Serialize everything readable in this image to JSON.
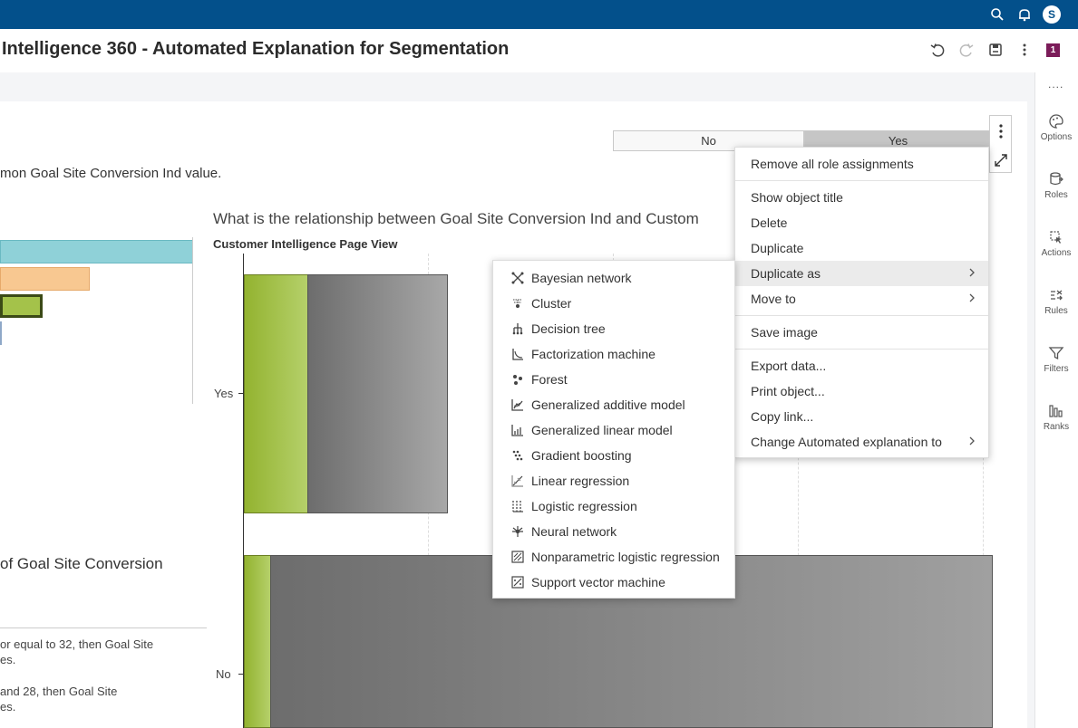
{
  "topbar": {
    "avatar_letter": "S",
    "search_icon": "search-icon",
    "notifications_icon": "bell-icon"
  },
  "header": {
    "title": "Intelligence 360 - Automated Explanation for Segmentation",
    "page_count": "1",
    "icons": [
      "undo-icon",
      "redo-icon",
      "save-icon",
      "more-vertical-icon"
    ]
  },
  "rail": {
    "more": "....",
    "items": [
      {
        "label": "Options",
        "icon": "palette-icon"
      },
      {
        "label": "Roles",
        "icon": "database-icon"
      },
      {
        "label": "Actions",
        "icon": "cursor-icon"
      },
      {
        "label": "Rules",
        "icon": "rules-icon"
      },
      {
        "label": "Filters",
        "icon": "filter-icon"
      },
      {
        "label": "Ranks",
        "icon": "ranks-icon"
      }
    ]
  },
  "toggle": {
    "no": "No",
    "yes": "Yes",
    "selected": "Yes"
  },
  "content": {
    "explain_text": "mon Goal Site Conversion Ind value.",
    "chart_title": "What is the relationship between Goal Site Conversion Ind and Custom",
    "axis_title": "Customer Intelligence Page View",
    "y_labels": [
      "Yes",
      "No"
    ],
    "section_title": "of Goal Site Conversion",
    "rules": [
      {
        "line1": "or equal to 32, then Goal Site",
        "line2": "es."
      },
      {
        "line1": "and 28, then Goal Site",
        "line2": "es."
      }
    ]
  },
  "colors": {
    "topbar": "#03508b",
    "teal_bar": "#8fd1d8",
    "orange_bar": "#f8c891",
    "green_bar": "#a4c24a",
    "gray_bar": "#8c8c8c",
    "badge": "#7b1c59"
  },
  "context_menu": {
    "items": [
      {
        "label": "Remove all role assignments"
      },
      {
        "label": "Show object title"
      },
      {
        "label": "Delete"
      },
      {
        "label": "Duplicate"
      },
      {
        "label": "Duplicate as",
        "submenu": true,
        "highlighted": true
      },
      {
        "label": "Move to",
        "submenu": true
      },
      {
        "label": "Save image"
      },
      {
        "label": "Export data..."
      },
      {
        "label": "Print object..."
      },
      {
        "label": "Copy link..."
      },
      {
        "label": "Change Automated explanation to",
        "submenu": true
      }
    ]
  },
  "duplicate_as_menu": {
    "items": [
      {
        "label": "Bayesian network",
        "icon": "bayesian-network-icon"
      },
      {
        "label": "Cluster",
        "icon": "cluster-icon"
      },
      {
        "label": "Decision tree",
        "icon": "decision-tree-icon"
      },
      {
        "label": "Factorization machine",
        "icon": "factorization-machine-icon"
      },
      {
        "label": "Forest",
        "icon": "forest-icon"
      },
      {
        "label": "Generalized additive model",
        "icon": "gam-icon"
      },
      {
        "label": "Generalized linear model",
        "icon": "glm-icon"
      },
      {
        "label": "Gradient boosting",
        "icon": "gradient-boosting-icon"
      },
      {
        "label": "Linear regression",
        "icon": "linear-regression-icon"
      },
      {
        "label": "Logistic regression",
        "icon": "logistic-regression-icon"
      },
      {
        "label": "Neural network",
        "icon": "neural-network-icon"
      },
      {
        "label": "Nonparametric logistic regression",
        "icon": "nonparametric-logistic-regression-icon"
      },
      {
        "label": "Support vector machine",
        "icon": "svm-icon"
      }
    ]
  }
}
